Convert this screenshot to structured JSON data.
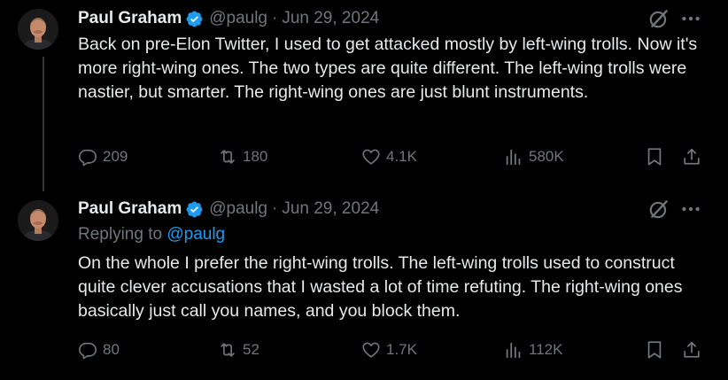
{
  "tweets": [
    {
      "author_name": "Paul Graham",
      "handle": "@paulg",
      "separator": "·",
      "date": "Jun 29, 2024",
      "replying_prefix": "",
      "replying_to": "",
      "text": "Back on pre-Elon Twitter, I used to get attacked mostly by left-wing trolls. Now it's more right-wing ones. The two types are quite different. The left-wing trolls were nastier, but smarter. The right-wing ones are just blunt instruments.",
      "stats": {
        "replies": "209",
        "reposts": "180",
        "likes": "4.1K",
        "views": "580K"
      }
    },
    {
      "author_name": "Paul Graham",
      "handle": "@paulg",
      "separator": "·",
      "date": "Jun 29, 2024",
      "replying_prefix": "Replying to",
      "replying_to": "@paulg",
      "text": "On the whole I prefer the right-wing trolls. The left-wing trolls used to construct quite clever accusations that I wasted a lot of time refuting. The right-wing ones basically just call you names, and you block them.",
      "stats": {
        "replies": "80",
        "reposts": "52",
        "likes": "1.7K",
        "views": "112K"
      }
    }
  ],
  "icons": {
    "verified": "verified-badge-icon",
    "grok": "grok-icon",
    "more": "more-dots-icon",
    "reply": "reply-icon",
    "repost": "repost-icon",
    "like": "heart-icon",
    "views": "views-icon",
    "bookmark": "bookmark-icon",
    "share": "share-icon"
  },
  "colors": {
    "background": "#000000",
    "text": "#e7e9ea",
    "muted": "#71767b",
    "accent": "#1d9bf0",
    "thread_line": "#333639"
  }
}
